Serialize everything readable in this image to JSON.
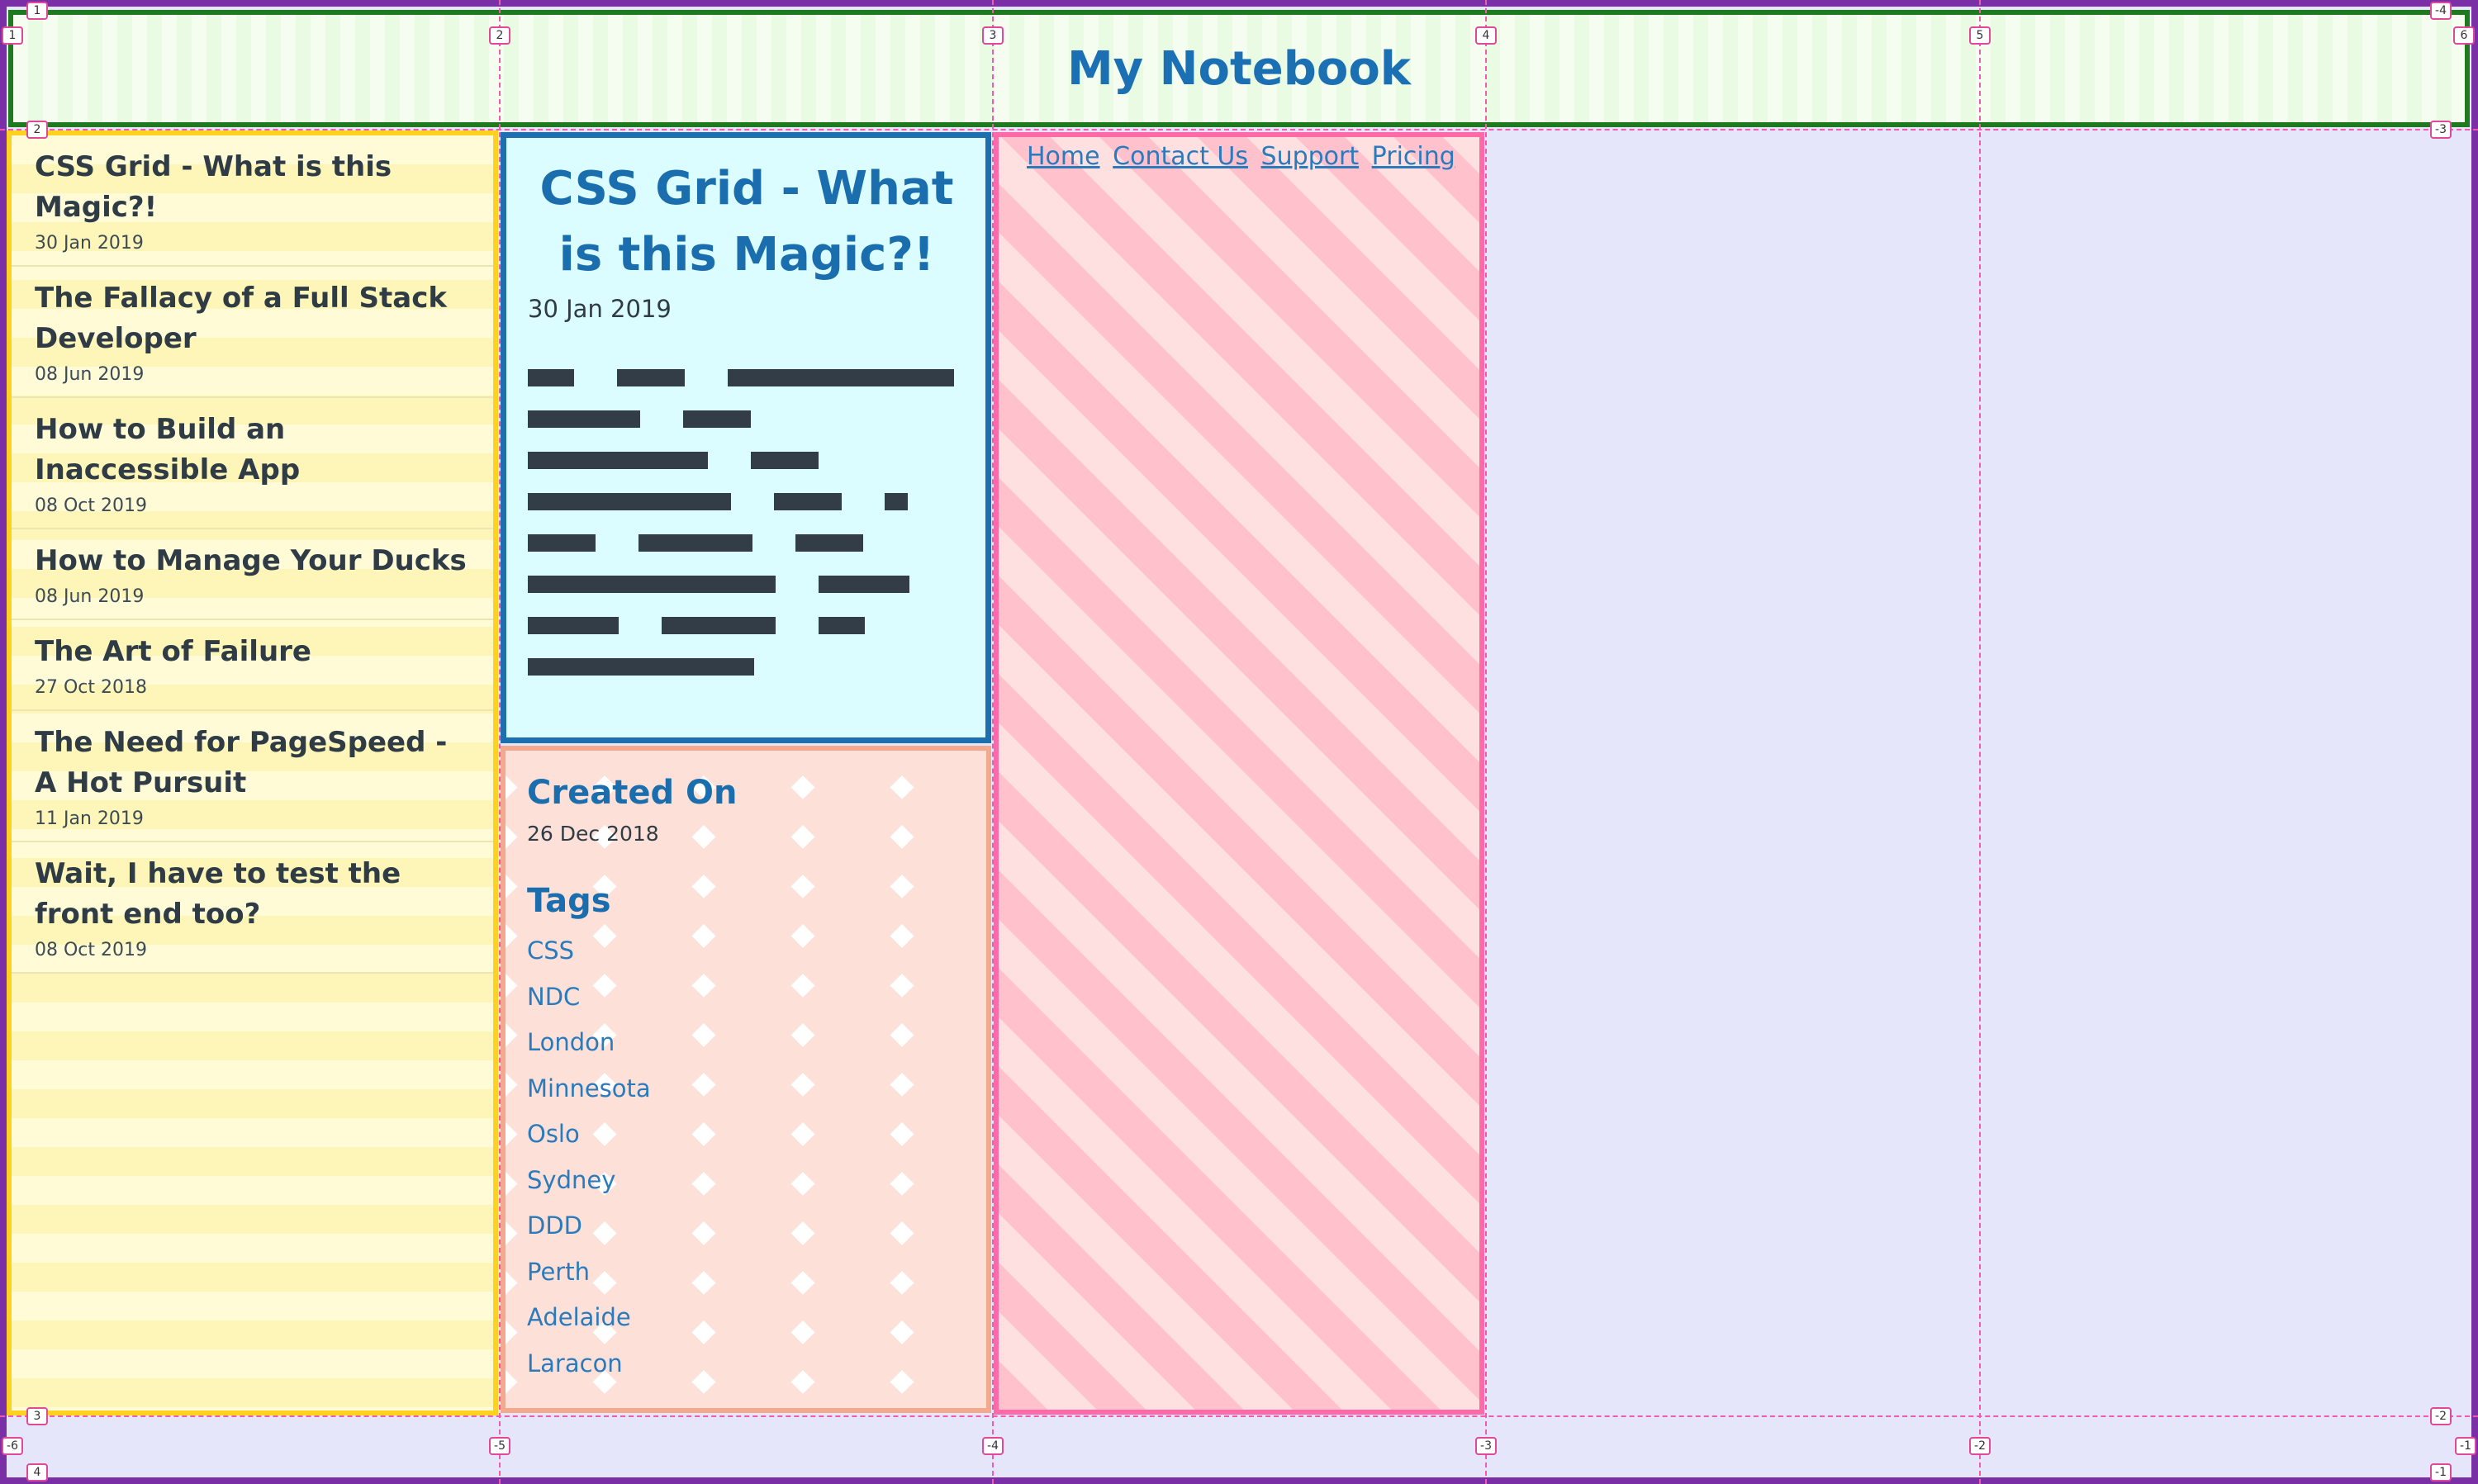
{
  "header": {
    "title": "My Notebook"
  },
  "sidebar": {
    "posts": [
      {
        "title": "CSS Grid - What is this Magic?!",
        "date": "30 Jan 2019"
      },
      {
        "title": "The Fallacy of a Full Stack Developer",
        "date": "08 Jun 2019"
      },
      {
        "title": "How to Build an Inaccessible App",
        "date": "08 Oct 2019"
      },
      {
        "title": "How to Manage Your Ducks",
        "date": "08 Jun 2019"
      },
      {
        "title": "The Art of Failure",
        "date": "27 Oct 2018"
      },
      {
        "title": "The Need for PageSpeed - A Hot Pursuit",
        "date": "11 Jan 2019"
      },
      {
        "title": "Wait, I have to test the front end too?",
        "date": "08 Oct 2019"
      }
    ]
  },
  "article": {
    "title": "CSS Grid - What is this Magic?!",
    "date": "30 Jan 2019"
  },
  "meta": {
    "created_heading": "Created On",
    "created_date": "26 Dec 2018",
    "tags_heading": "Tags",
    "tags": [
      "CSS",
      "NDC",
      "London",
      "Minnesota",
      "Oslo",
      "Sydney",
      "DDD",
      "Perth",
      "Adelaide",
      "Laracon"
    ]
  },
  "nav": {
    "links": [
      "Home",
      "Contact Us",
      "Support",
      "Pricing"
    ]
  },
  "grid_overlay": {
    "col_top_labels": [
      "1",
      "2",
      "3",
      "4",
      "5",
      "6"
    ],
    "col_bottom_labels": [
      "-6",
      "-5",
      "-4",
      "-3",
      "-2",
      "-1"
    ],
    "row_left_labels": [
      "1",
      "2",
      "3",
      "4"
    ],
    "row_right_labels": [
      "-4",
      "-3",
      "-2",
      "-1"
    ]
  },
  "colors": {
    "accent": "#1b6fb3",
    "header_border": "#1f7a1f",
    "sidebar_border": "#ffd21f",
    "article_border": "#1e6fb0",
    "meta_border": "#f2a98d",
    "nav_border": "#ff69a8",
    "frame": "#7b2fa6",
    "grid_line": "#f15ab0"
  }
}
